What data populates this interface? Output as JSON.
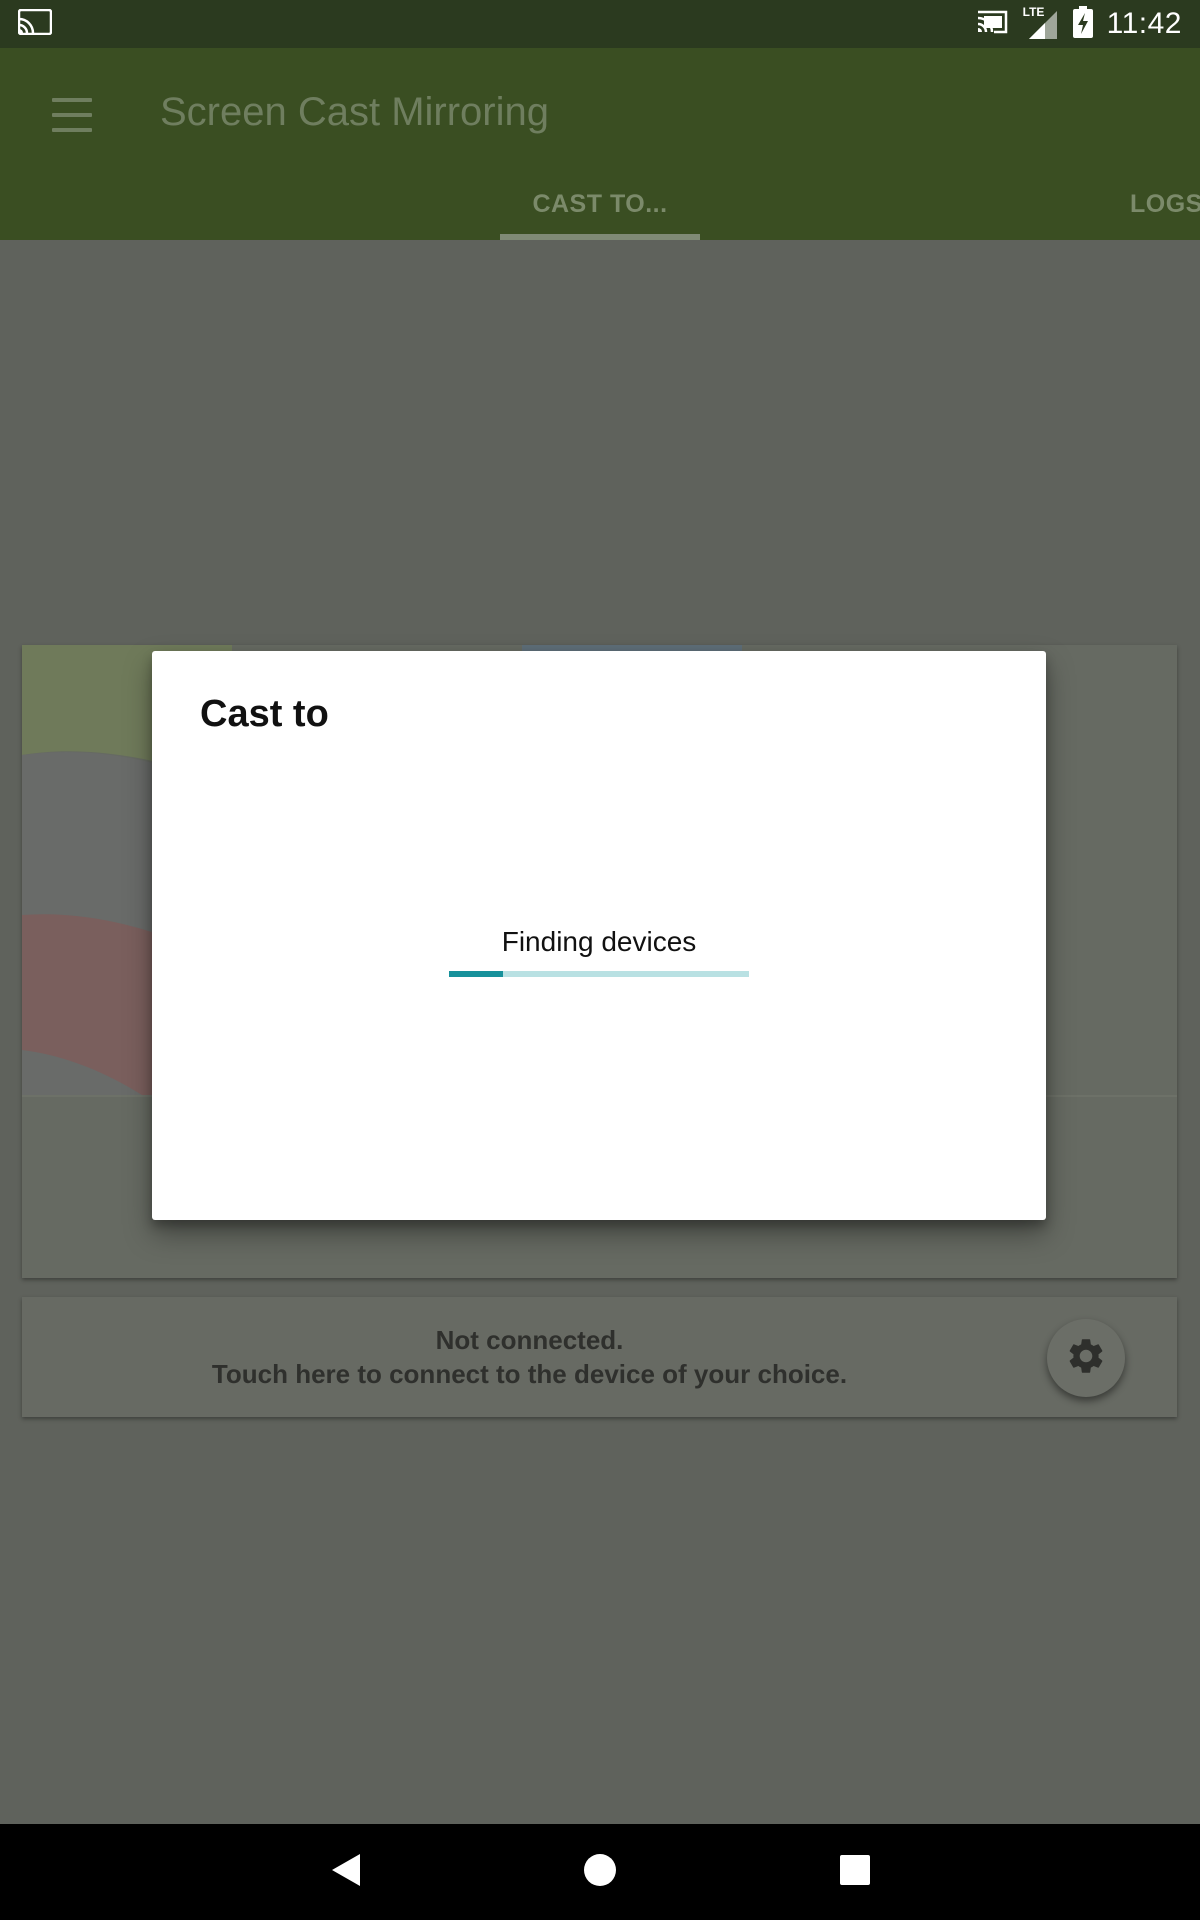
{
  "status_bar": {
    "time": "11:42",
    "network_label": "LTE",
    "icons": [
      "cast-app-icon",
      "cast-connected-icon",
      "signal-icon",
      "battery-charging-icon"
    ]
  },
  "app_bar": {
    "title": "Screen Cast Mirroring",
    "tabs": [
      {
        "label": "CAST TO...",
        "selected": true
      },
      {
        "label": "LOGS",
        "selected": false
      }
    ]
  },
  "connection_card": {
    "line1": "Not connected.",
    "line2": "Touch here to connect to the device of your choice."
  },
  "dialog": {
    "title": "Cast to",
    "status": "Finding devices",
    "progress": 0.18
  },
  "colors": {
    "status_bar": "#2b3a1f",
    "app_bar": "#3a4e22",
    "scrim_background": "#5f625c",
    "progress_fill": "#17919b",
    "progress_track": "#b9e1e3"
  },
  "nav_bar": {
    "buttons": [
      "back-icon",
      "home-icon",
      "recents-icon"
    ]
  }
}
